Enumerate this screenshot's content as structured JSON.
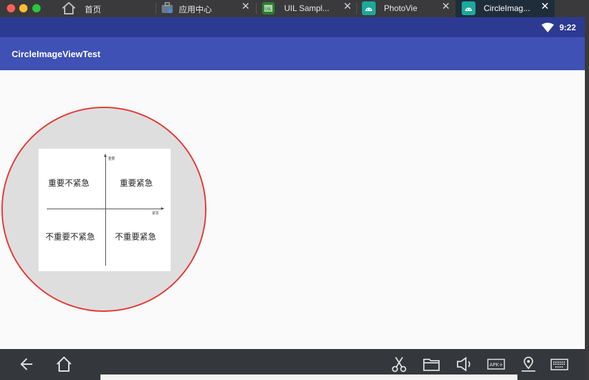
{
  "browser": {
    "home_tab_label": "首页",
    "tabs": [
      {
        "label": "应用中心",
        "icon": "app-center-icon",
        "active": false
      },
      {
        "label": "UIL Sampl...",
        "icon": "uil-app-icon",
        "active": false
      },
      {
        "label": "PhotoVie",
        "icon": "android-icon",
        "active": false
      },
      {
        "label": "CircleImag...",
        "icon": "android-icon",
        "active": true
      }
    ],
    "close_glyph": "✕"
  },
  "status_bar": {
    "time": "9:22",
    "icons": [
      "wifi-icon"
    ],
    "color": "#2c3a92"
  },
  "app_bar": {
    "title": "CircleImageViewTest",
    "color": "#3f51b5"
  },
  "circle_image": {
    "border_color": "#e53935",
    "background_color": "#dedede",
    "axis_labels": {
      "y": "重要",
      "x": "紧急"
    },
    "quadrants": {
      "top_left": "重要不紧急",
      "top_right": "重要紧急",
      "bottom_left": "不重要不紧急",
      "bottom_right": "不重要紧急"
    }
  },
  "nav_bar": {
    "left_icons": [
      "back-icon",
      "home-icon"
    ],
    "right_icons": [
      "screenshot-cut-icon",
      "folder-icon",
      "volume-icon",
      "apk-install-icon",
      "location-icon",
      "keyboard-icon"
    ],
    "apk_label": "APK+",
    "color": "#34383c"
  }
}
